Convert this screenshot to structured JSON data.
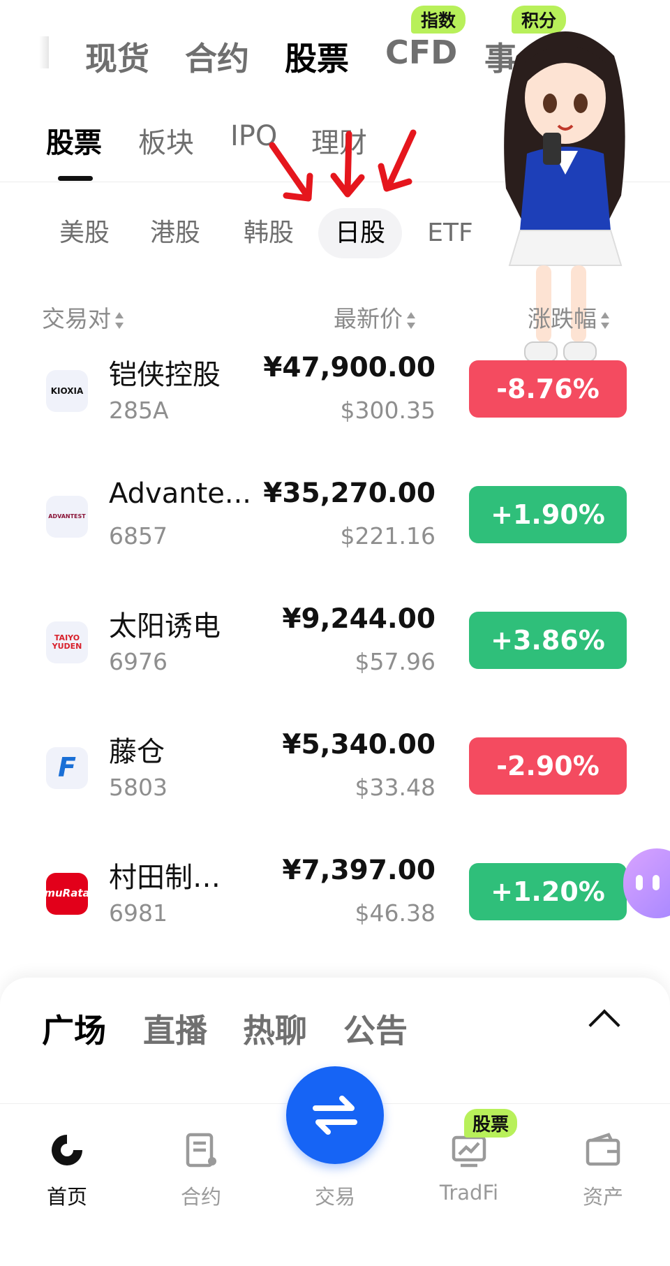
{
  "top_tabs": [
    {
      "label": "现货"
    },
    {
      "label": "合约"
    },
    {
      "label": "股票"
    },
    {
      "label": "CFD"
    },
    {
      "label": "事"
    }
  ],
  "top_badges": [
    "指数",
    "积分"
  ],
  "sub_tabs": [
    {
      "label": "股票"
    },
    {
      "label": "板块"
    },
    {
      "label": "IPO"
    },
    {
      "label": "理财"
    }
  ],
  "markets": [
    {
      "label": "美股"
    },
    {
      "label": "港股"
    },
    {
      "label": "韩股"
    },
    {
      "label": "日股"
    },
    {
      "label": "ETF"
    }
  ],
  "columns": {
    "pair": "交易对",
    "price": "最新价",
    "change": "涨跌幅"
  },
  "stocks": [
    {
      "logo": "KIOXIA",
      "logo_color": "#111111",
      "name": "铠侠控股",
      "code": "285A",
      "price": "¥47,900.00",
      "usd": "$300.35",
      "change": "-8.76%",
      "direction": "down"
    },
    {
      "logo": "ADVANTEST",
      "logo_color": "#8a1538",
      "name": "Advante...",
      "code": "6857",
      "price": "¥35,270.00",
      "usd": "$221.16",
      "change": "+1.90%",
      "direction": "up"
    },
    {
      "logo": "TAIYO YUDEN",
      "logo_color": "#d8202b",
      "name": "太阳诱电",
      "code": "6976",
      "price": "¥9,244.00",
      "usd": "$57.96",
      "change": "+3.86%",
      "direction": "up"
    },
    {
      "logo": "F",
      "logo_color": "#1a6fd6",
      "name": "藤仓",
      "code": "5803",
      "price": "¥5,340.00",
      "usd": "$33.48",
      "change": "-2.90%",
      "direction": "down"
    },
    {
      "logo": "muRata",
      "logo_color": "#ffffff",
      "name": "村田制…",
      "code": "6981",
      "price": "¥7,397.00",
      "usd": "$46.38",
      "change": "+1.20%",
      "direction": "up"
    }
  ],
  "community_tabs": [
    {
      "label": "广场"
    },
    {
      "label": "直播"
    },
    {
      "label": "热聊"
    },
    {
      "label": "公告"
    }
  ],
  "bottom_nav": [
    {
      "label": "首页",
      "icon": "home-icon"
    },
    {
      "label": "合约",
      "icon": "contract-icon"
    },
    {
      "label": "交易",
      "icon": "swap-icon"
    },
    {
      "label": "TradFi",
      "icon": "tradfi-icon"
    },
    {
      "label": "资产",
      "icon": "wallet-icon"
    }
  ],
  "nav_badge": "股票",
  "colors": {
    "down": "#f44b60",
    "up": "#2fbf7a",
    "accent": "#1664f5",
    "badge": "#b8f05a"
  }
}
